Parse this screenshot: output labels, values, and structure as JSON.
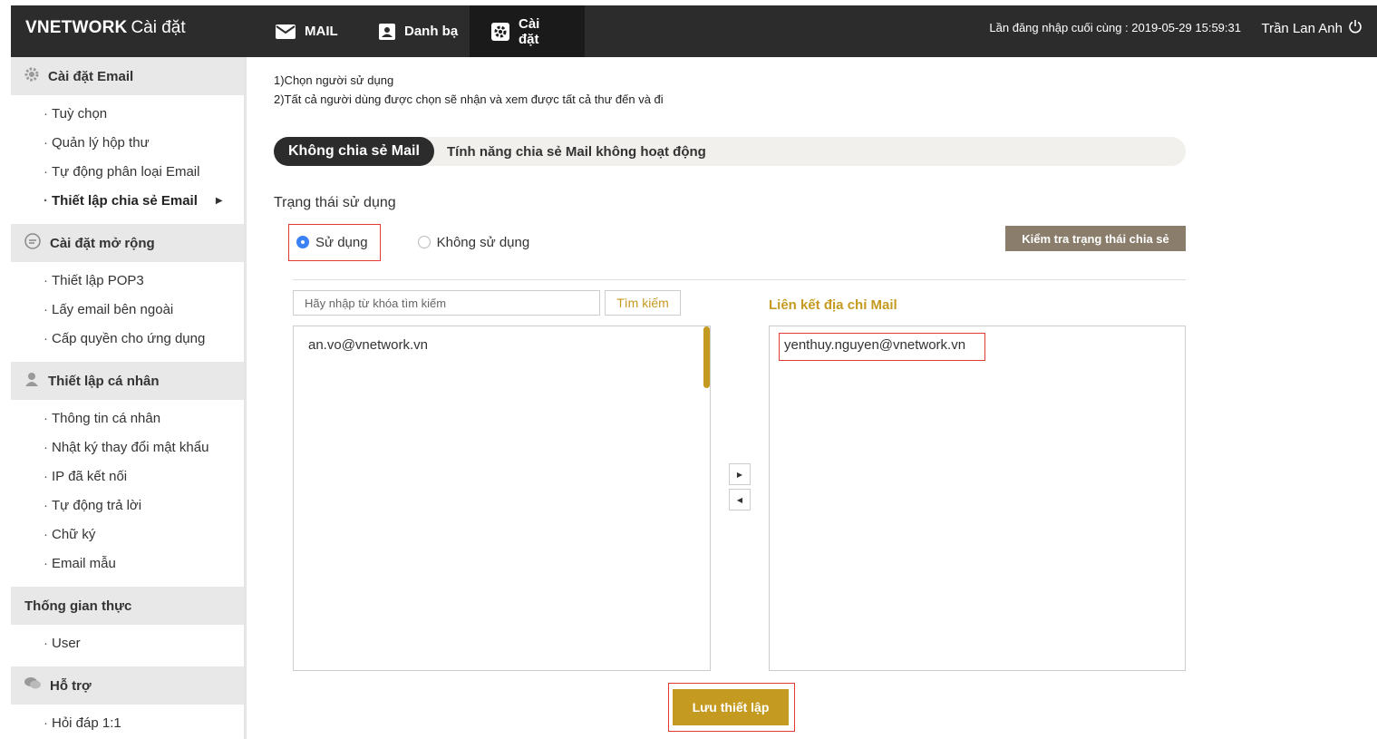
{
  "header": {
    "logo_brand": "VNETWORK",
    "logo_sub": "Cài đặt",
    "tabs": [
      {
        "label": "MAIL",
        "icon": "mail-icon"
      },
      {
        "label": "Danh bạ",
        "icon": "contacts-icon"
      },
      {
        "label": "Cài đặt",
        "icon": "settings-icon",
        "active": true
      }
    ],
    "last_login": "Lần đăng nhập cuối cùng : 2019-05-29 15:59:31",
    "user_name": "Trần Lan Anh",
    "power_icon": "power-icon"
  },
  "sidebar": {
    "sections": [
      {
        "title": "Cài đặt Email",
        "icon": "gear-icon",
        "items": [
          "Tuỳ chọn",
          "Quản lý hộp thư",
          "Tự động phân loại Email",
          "Thiết lập chia sẻ Email"
        ]
      },
      {
        "title": "Cài đặt mở rộng",
        "icon": "extension-icon",
        "items": [
          "Thiết lập POP3",
          "Lấy email bên ngoài",
          "Cấp quyền cho ứng dụng"
        ]
      },
      {
        "title": "Thiết lập cá nhân",
        "icon": "person-icon",
        "items": [
          "Thông tin cá nhân",
          "Nhật ký thay đổi mật khẩu",
          "IP đã kết nối",
          "Tự động trả lời",
          "Chữ ký",
          "Email mẫu"
        ]
      },
      {
        "title": "Thống gian thực",
        "icon": "",
        "items": [
          "User"
        ]
      },
      {
        "title": "Hỗ trợ",
        "icon": "chat-icon",
        "items": [
          "Hỏi đáp 1:1"
        ]
      }
    ],
    "item_prefix": "·",
    "active_item": "Thiết lập chia sẻ Email"
  },
  "main": {
    "note_1": "1)Chọn người sử dụng",
    "note_2": "2)Tất cả người dùng được chọn sẽ nhận và xem được tất cả thư đến và đi",
    "status_badge": "Không chia sẻ Mail",
    "status_message": "Tính năng chia sẻ Mail không hoạt động",
    "usage_title": "Trạng thái sử dụng",
    "radio_use": "Sử dụng",
    "radio_not_use": "Không sử dụng",
    "radio_selected": "Sử dụng",
    "check_button": "Kiểm tra trạng thái chia sẻ",
    "search_placeholder": "Hãy nhập từ khóa tìm kiếm",
    "search_button": "Tìm kiếm",
    "linked_title": "Liên kết địa chỉ Mail",
    "available_users": [
      "an.vo@vnetwork.vn"
    ],
    "linked_users": [
      "yenthuy.nguyen@vnetwork.vn"
    ],
    "move_right_icon": "arrow-right-icon",
    "move_left_icon": "arrow-left-icon",
    "save_button": "Lưu thiết lập"
  },
  "colors": {
    "accent": "#c49a20",
    "header_bg": "#2c2c2c",
    "highlight": "#e53935",
    "check_button_bg": "#8a7d6b"
  }
}
